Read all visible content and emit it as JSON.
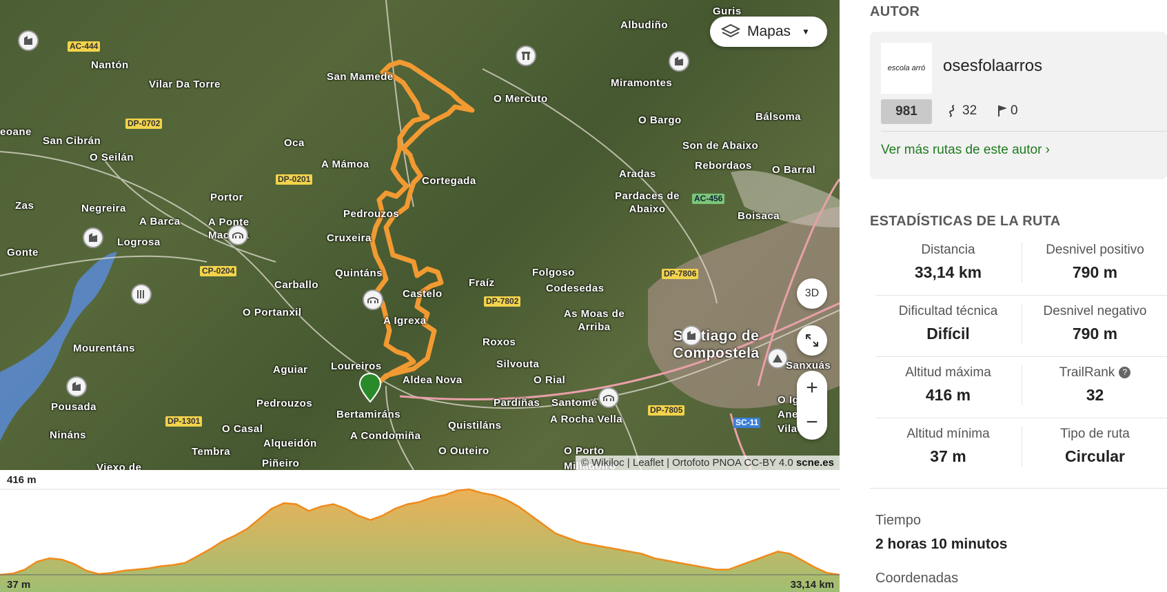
{
  "map": {
    "layer_button": "Mapas",
    "btn_3d": "3D",
    "zoom_in": "+",
    "zoom_out": "−",
    "attribution": "© Wikiloc | Leaflet | Ortofoto PNOA CC-BY 4.0",
    "attribution_brand": "scne.es",
    "places": [
      "Guris",
      "Albudiño",
      "Nantón",
      "Vilar Da Torre",
      "San Mamede",
      "O Mercuto",
      "Miramontes",
      "O Bargo",
      "Bálsoma",
      "eoane",
      "San Cibrán",
      "O Seilán",
      "Oca",
      "A Mámoa",
      "Son de Abaixo",
      "Rebordaos",
      "O Barral",
      "Cortegada",
      "Aradas",
      "Zas",
      "Portor",
      "Pardaces de Abaixo",
      "Negreira",
      "A Barca",
      "A Ponte Maceira",
      "Pedrouzos",
      "Boisaca",
      "Logrosa",
      "Cruxeira",
      "Gonte",
      "Quintáns",
      "Carballo",
      "Fraíz",
      "Folgoso",
      "Codesedas",
      "Castelo",
      "O Portanxil",
      "A Igrexa",
      "As Moas de Arriba",
      "Santiago de Compostela",
      "Mourentáns",
      "Roxos",
      "Aguiar",
      "Loureiros",
      "Silvouta",
      "Sanxuás",
      "Aldea Nova",
      "O Rial",
      "Pousada",
      "Pedrouzos",
      "Pardiñas",
      "Santomé",
      "Bertamiráns",
      "Quistiláns",
      "A Rocha Vella",
      "Nináns",
      "O Casal",
      "Alqueidón",
      "A Condomiña",
      "O Outeiro",
      "O Porto",
      "Tembra",
      "Viexo de",
      "Piñeiro",
      "Milladoiro",
      "Aneiro",
      "Vilacova",
      "O Igrexa"
    ],
    "roads": [
      "AC-444",
      "DP-0702",
      "DP-0201",
      "CP-0204",
      "AC-456",
      "DP-7806",
      "DP-7802",
      "DP-1301",
      "DP-7805",
      "SC-11"
    ],
    "colors": {
      "track": "#f29a32",
      "water": "#5b8bd6",
      "urban": "#e8a0a8"
    }
  },
  "elevation": {
    "max_label": "416 m",
    "min_label": "37 m",
    "distance_label": "33,14 km",
    "profile": [
      37,
      42,
      60,
      95,
      110,
      105,
      85,
      55,
      40,
      45,
      55,
      60,
      65,
      75,
      80,
      90,
      120,
      150,
      185,
      210,
      240,
      285,
      330,
      355,
      350,
      320,
      340,
      350,
      330,
      300,
      280,
      300,
      330,
      350,
      360,
      380,
      390,
      410,
      416,
      400,
      390,
      370,
      340,
      300,
      260,
      220,
      200,
      180,
      170,
      160,
      150,
      140,
      130,
      110,
      100,
      90,
      80,
      70,
      60,
      60,
      80,
      100,
      120,
      140,
      130,
      100,
      70,
      45,
      37
    ]
  },
  "sidebar": {
    "author_title": "AUTOR",
    "author_logo_text": "escola arró",
    "author_name": "osesfolaarros",
    "author_badge": "981",
    "author_routes": "32",
    "author_followers": "0",
    "author_link": "Ver más rutas de este autor ›",
    "stats_title": "ESTADÍSTICAS DE LA RUTA",
    "stats": [
      {
        "l_label": "Distancia",
        "l_value": "33,14 km",
        "r_label": "Desnivel positivo",
        "r_value": "790 m"
      },
      {
        "l_label": "Dificultad técnica",
        "l_value": "Difícil",
        "r_label": "Desnivel negativo",
        "r_value": "790 m"
      },
      {
        "l_label": "Altitud máxima",
        "l_value": "416 m",
        "r_label": "TrailRank",
        "r_value": "32"
      },
      {
        "l_label": "Altitud mínima",
        "l_value": "37 m",
        "r_label": "Tipo de ruta",
        "r_value": "Circular"
      }
    ],
    "time_label": "Tiempo",
    "time_value": "2 horas 10 minutos",
    "coords_label": "Coordenadas"
  }
}
